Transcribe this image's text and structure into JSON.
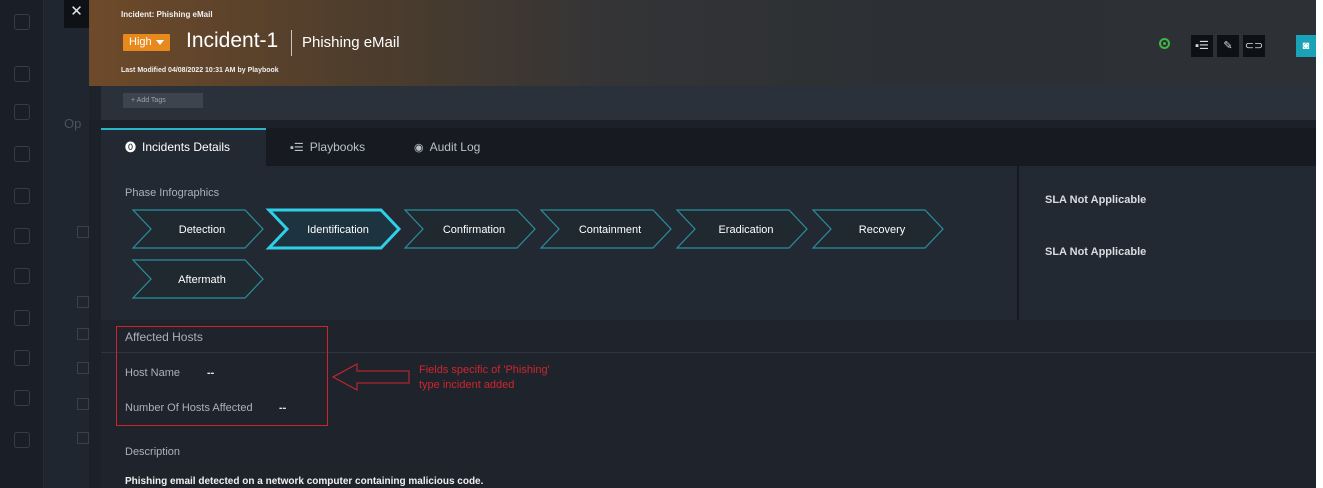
{
  "header": {
    "breadcrumb": "Incident: Phishing eMail",
    "priority": "High",
    "incident_id": "Incident-1",
    "incident_name": "Phishing eMail",
    "last_modified": "Last Modified 04/08/2022 10:31 AM by Playbook",
    "close_icon": "close-icon",
    "actions": [
      "playbooks-icon",
      "edit-icon",
      "link-icon",
      "chat-icon"
    ]
  },
  "tags": {
    "add_label": "+ Add Tags"
  },
  "background": {
    "partial_label": "Op"
  },
  "tabs": [
    {
      "label": "Incidents Details",
      "icon": "info-icon",
      "active": true
    },
    {
      "label": "Playbooks",
      "icon": "playbooks-icon",
      "active": false
    },
    {
      "label": "Audit Log",
      "icon": "eye-icon",
      "active": false
    }
  ],
  "phases": {
    "title": "Phase Infographics",
    "items": [
      "Detection",
      "Identification",
      "Confirmation",
      "Containment",
      "Eradication",
      "Recovery",
      "Aftermath"
    ],
    "active": "Identification"
  },
  "sla": [
    "SLA Not Applicable",
    "SLA Not Applicable"
  ],
  "affected_hosts": {
    "title": "Affected Hosts",
    "fields": [
      {
        "label": "Host Name",
        "value": "--"
      },
      {
        "label": "Number Of Hosts Affected",
        "value": "--"
      }
    ]
  },
  "annotation": {
    "line1": "Fields specific of 'Phishing'",
    "line2": "type incident added"
  },
  "description": {
    "label": "Description",
    "text": "Phishing email detected on a network computer containing malicious code."
  },
  "colors": {
    "accent": "#2ab6c6",
    "priority": "#e8891d",
    "status": "#3db843",
    "annotation": "#d0242c"
  }
}
